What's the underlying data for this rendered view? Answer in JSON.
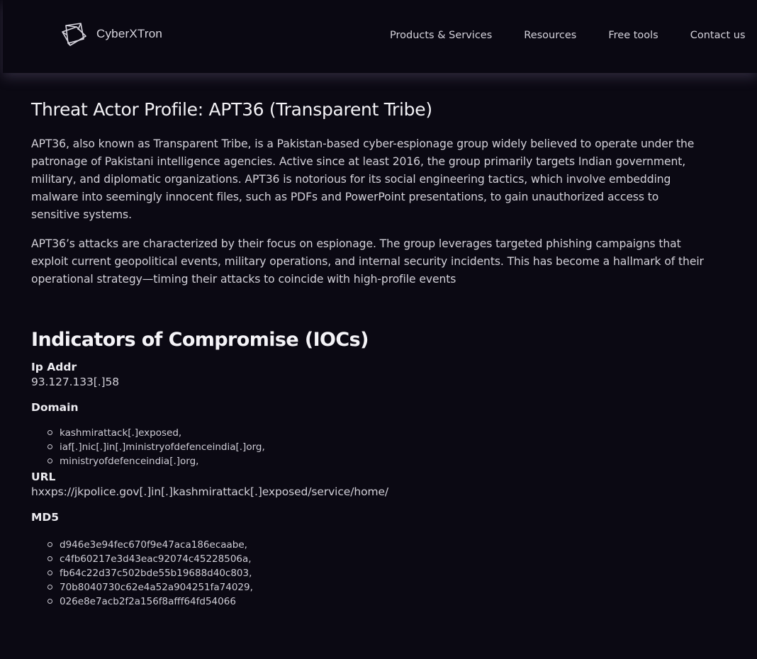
{
  "header": {
    "brand": "CyberXTron",
    "nav": [
      "Products & Services",
      "Resources",
      "Free tools",
      "Contact us"
    ]
  },
  "profile": {
    "title": "Threat Actor Profile: APT36 (Transparent Tribe)",
    "paragraphs": [
      "APT36, also known as Transparent Tribe, is a Pakistan-based cyber-espionage group widely believed to operate under the patronage of Pakistani intelligence agencies. Active since at least 2016, the group primarily targets Indian government, military, and diplomatic organizations. APT36 is notorious for its social engineering tactics, which involve embedding malware into seemingly innocent files, such as PDFs and PowerPoint presentations, to gain unauthorized access to sensitive systems.",
      "APT36’s attacks are characterized by their focus on espionage. The group leverages targeted phishing campaigns that exploit current geopolitical events, military operations, and internal security incidents. This has become a hallmark of their operational strategy—timing their attacks to coincide with high-profile events"
    ]
  },
  "iocs": {
    "heading": "Indicators of Compromise (IOCs)",
    "ip": {
      "label": "Ip Addr",
      "value": "93.127.133[.]58"
    },
    "domain": {
      "label": "Domain",
      "items": [
        "kashmirattack[.]exposed,",
        "iaf[.]nic[.]in[.]ministryofdefenceindia[.]org,",
        "ministryofdefenceindia[.]org,"
      ]
    },
    "url": {
      "label": "URL",
      "value": "hxxps://jkpolice.gov[.]in[.]kashmirattack[.]exposed/service/home/"
    },
    "md5": {
      "label": "MD5",
      "items": [
        "d946e3e94fec670f9e47aca186ecaabe,",
        "c4fb60217e3d43eac92074c45228506a,",
        "fb64c22d37c502bde55b19688d40c803,",
        "70b8040730c62e4a52a904251fa74029,",
        "026e8e7acb2f2a156f8afff64fd54066"
      ]
    }
  },
  "colors": {
    "background": "#0b0913",
    "header_bg": "#0a0812",
    "text": "#d3d1d9",
    "heading": "#f2f1f5"
  },
  "icons": {
    "logo": "cyberxtron-logo-icon"
  }
}
